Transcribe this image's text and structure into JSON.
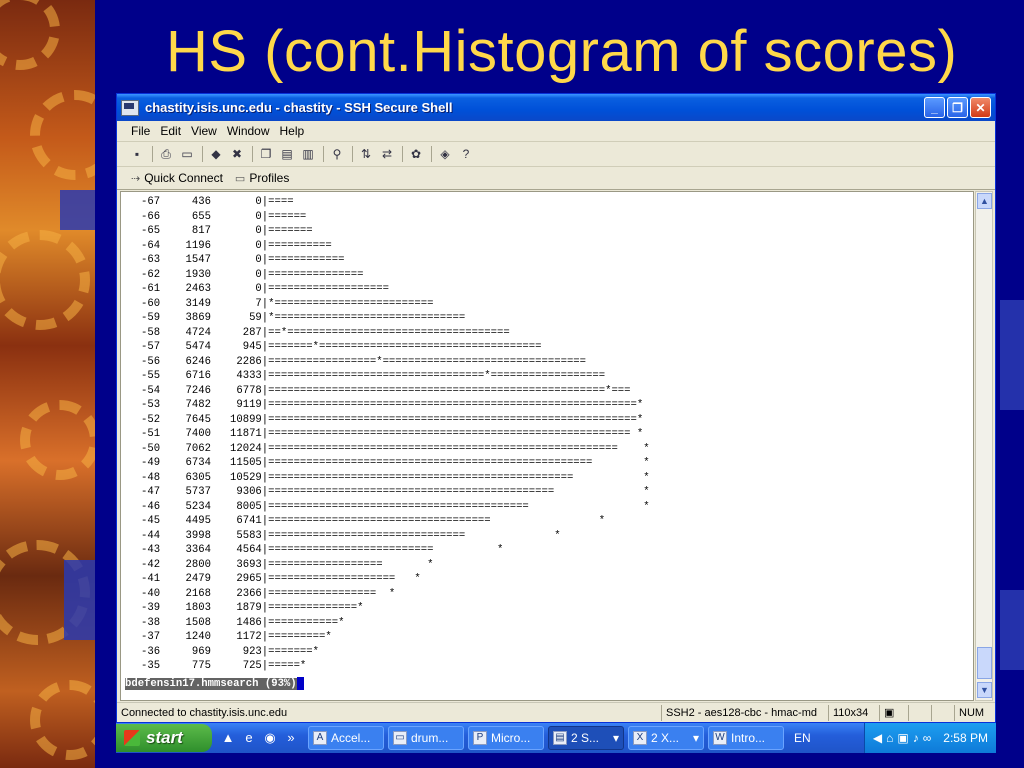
{
  "slide": {
    "title": "HS (cont.Histogram of scores)"
  },
  "window": {
    "title": "chastity.isis.unc.edu - chastity - SSH Secure Shell",
    "menu": [
      "File",
      "Edit",
      "View",
      "Window",
      "Help"
    ],
    "quick_connect": "Quick Connect",
    "profiles": "Profiles"
  },
  "terminal": {
    "lines": [
      "-67     436       0|====",
      "-66     655       0|======",
      "-65     817       0|=======",
      "-64    1196       0|==========",
      "-63    1547       0|============",
      "-62    1930       0|===============",
      "-61    2463       0|===================",
      "-60    3149       7|*=========================",
      "-59    3869      59|*==============================",
      "-58    4724     287|==*===================================",
      "-57    5474     945|=======*===================================",
      "-56    6246    2286|=================*================================",
      "-55    6716    4333|==================================*==================",
      "-54    7246    6778|=====================================================*===",
      "-53    7482    9119|==========================================================*",
      "-52    7645   10899|==========================================================*",
      "-51    7400   11871|========================================================= *",
      "-50    7062   12024|=======================================================    *",
      "-49    6734   11505|===================================================        *",
      "-48    6305   10529|================================================           *",
      "-47    5737    9306|=============================================              *",
      "-46    5234    8005|=========================================                  *",
      "-45    4495    6741|===================================                 *",
      "-44    3998    5583|===============================              *",
      "-43    3364    4564|==========================          *",
      "-42    2800    3693|==================       *",
      "-41    2479    2965|====================   *",
      "-40    2168    2366|=================  *",
      "-39    1803    1879|==============*",
      "-38    1508    1486|===========*",
      "-37    1240    1172|=========*",
      "-36     969     923|=======*",
      "-35     775     725|=====*"
    ],
    "prompt": "bdefensin17.hmmsearch (93%)"
  },
  "statusbar": {
    "connection": "Connected to chastity.isis.unc.edu",
    "cipher": "SSH2 - aes128-cbc - hmac-md",
    "size": "110x34",
    "num": "NUM"
  },
  "taskbar": {
    "start": "start",
    "buttons": [
      "Accel...",
      "drum...",
      "Micro...",
      "2 S...",
      "2 X...",
      "Intro..."
    ],
    "lang": "EN",
    "clock": "2:58 PM"
  }
}
